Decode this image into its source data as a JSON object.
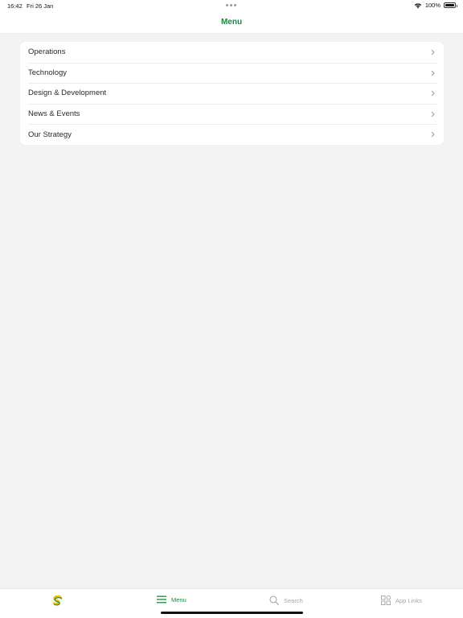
{
  "status_bar": {
    "time": "16:42",
    "date": "Fri 26 Jan",
    "battery": "100%"
  },
  "header": {
    "title": "Menu"
  },
  "menu": {
    "items": [
      {
        "label": "Operations"
      },
      {
        "label": "Technology"
      },
      {
        "label": "Design & Development"
      },
      {
        "label": "News & Events"
      },
      {
        "label": "Our Strategy"
      }
    ]
  },
  "tab_bar": {
    "home_icon": "subway-logo-icon",
    "menu_label": "Menu",
    "search_label": "Search",
    "app_links_label": "App Links"
  },
  "colors": {
    "accent": "#178a3c",
    "background": "#f3f3f3",
    "inactive_tab": "#a5a5a5"
  }
}
